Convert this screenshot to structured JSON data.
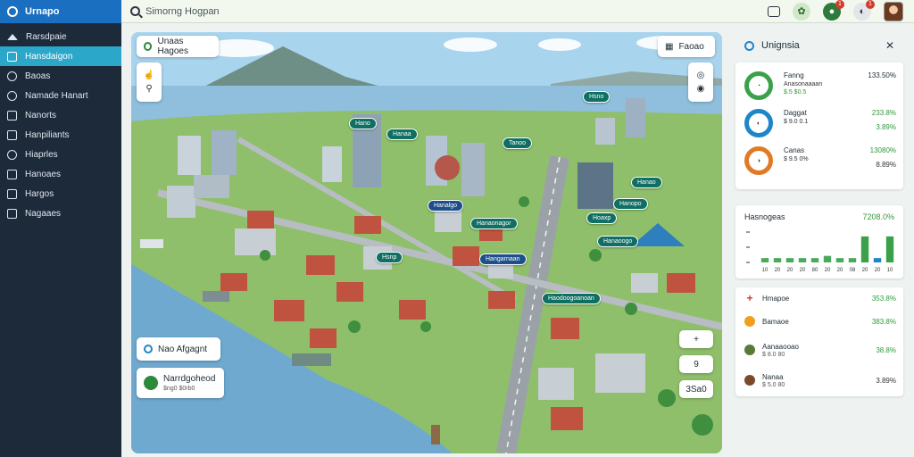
{
  "app": {
    "title": "Urnapo"
  },
  "sidebar": {
    "items": [
      {
        "label": "Rarsdpaie",
        "icon": "home-icon",
        "active": false
      },
      {
        "label": "Hansdaigon",
        "icon": "map-icon",
        "active": true
      },
      {
        "label": "Baoas",
        "icon": "circle-icon",
        "active": false
      },
      {
        "label": "Namade Hanart",
        "icon": "pin-icon",
        "active": false
      },
      {
        "label": "Nanorts",
        "icon": "chart-icon",
        "active": false
      },
      {
        "label": "Hanpiliants",
        "icon": "grid-icon",
        "active": false
      },
      {
        "label": "Hiaprles",
        "icon": "gear-icon",
        "active": false
      },
      {
        "label": "Hanoaes",
        "icon": "layers-icon",
        "active": false
      },
      {
        "label": "Hargos",
        "icon": "box-icon",
        "active": false
      },
      {
        "label": "Nagaaes",
        "icon": "folder-icon",
        "active": false
      }
    ]
  },
  "search": {
    "placeholder": "Simorng Hogpan"
  },
  "topbar": {
    "notif_count": "1",
    "alert_count": "1"
  },
  "map": {
    "overlay_top": "Unaas Hagoes",
    "overlay_right": "Faoao",
    "card1_title": "Nao Afgagnt",
    "card2_title": "Narrdgoheod",
    "card2_sub": "$ng0 $0rb0",
    "zoom_in": "+",
    "zoom_out": "9",
    "scale": "3Sa0",
    "labels": [
      {
        "text": "Hsno",
        "color": "teal"
      },
      {
        "text": "Hano",
        "color": "teal"
      },
      {
        "text": "Hanaa",
        "color": "teal"
      },
      {
        "text": "Tanoo",
        "color": "teal"
      },
      {
        "text": "Hanalgo",
        "color": "blue"
      },
      {
        "text": "Hanaonagor",
        "color": "teal"
      },
      {
        "text": "Hanao",
        "color": "teal"
      },
      {
        "text": "Hoaxp",
        "color": "teal"
      },
      {
        "text": "Hanopo",
        "color": "teal"
      },
      {
        "text": "Hanaoogo",
        "color": "teal"
      },
      {
        "text": "Hangarnaan",
        "color": "blue"
      },
      {
        "text": "Haodoogoanoan",
        "color": "teal"
      },
      {
        "text": "Hsnp",
        "color": "teal"
      }
    ]
  },
  "insights": {
    "title": "Unignsia",
    "stats": [
      {
        "label": "Fanng",
        "sub": "Anasonaaaan",
        "sub2": "$.5 $0.5",
        "v1": "133.50%",
        "v2": "",
        "color": "#3aa14a"
      },
      {
        "label": "Daggat",
        "sub": "$ 9.0 0.1",
        "sub2": "",
        "v1": "233.8%",
        "v2": "3.89%",
        "color": "#1e86c8"
      },
      {
        "label": "Canas",
        "sub": "$ 9.5 0%",
        "sub2": "",
        "v1": "13080%",
        "v2": "8.89%",
        "color": "#e07a24"
      }
    ]
  },
  "chart_data": {
    "type": "bar",
    "title": "Hasnogeas",
    "total_value": "7208.0%",
    "categories": [
      "10",
      "20",
      "20",
      "20",
      "80",
      "20",
      "20",
      "08",
      "20",
      "20",
      "10"
    ],
    "values": [
      2,
      2,
      2,
      2,
      2,
      3,
      2,
      2,
      12,
      2,
      12
    ],
    "ylim": [
      0,
      14
    ]
  },
  "list": {
    "rows": [
      {
        "label": "Hmapoe",
        "value": "353.8%",
        "icon": "red-plus-icon"
      },
      {
        "label": "Bamaoe",
        "value": "383.8%",
        "icon": "orange-pin-icon"
      },
      {
        "label": "Aanaaooao",
        "sub": "$ 8.0 80",
        "value": "38.8%",
        "icon": "green-avatar-icon"
      },
      {
        "label": "Nanaa",
        "sub": "$ 5.0 80",
        "value": "3.89%",
        "icon": "brown-avatar-icon"
      }
    ]
  }
}
